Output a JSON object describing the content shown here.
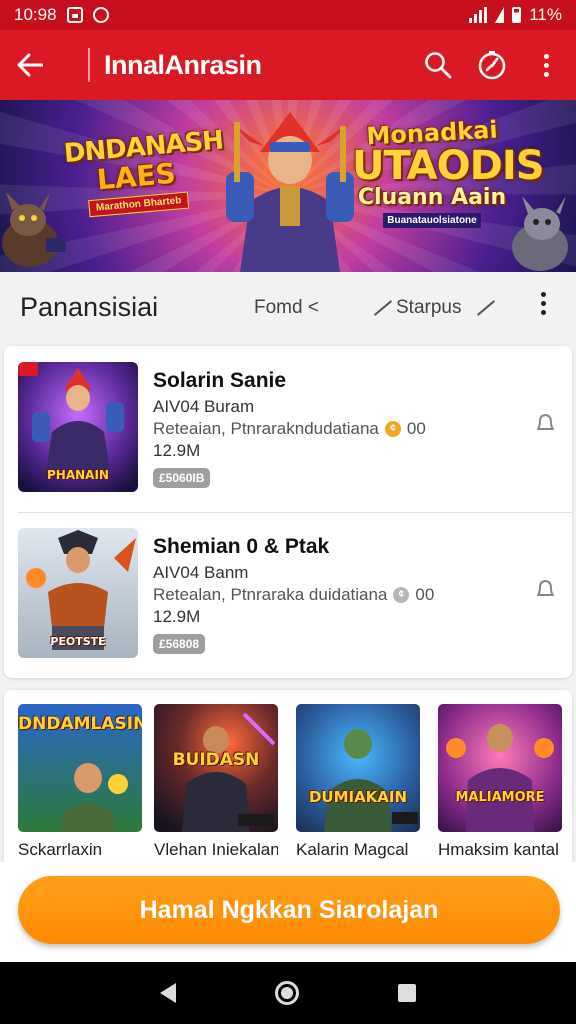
{
  "status_bar": {
    "time": "10:98",
    "battery": "11%"
  },
  "app_bar": {
    "title": "InnalAnrasin"
  },
  "banner": {
    "left_line1": "DNDANASH",
    "left_line2": "LAES",
    "left_tag": "Marathon Bharteb",
    "right_line1": "Monadkai",
    "right_line2": "UTAODIS",
    "right_line3": "Cluann Aain",
    "right_tag": "Buanatauolsiatone"
  },
  "section": {
    "title": "Panansisiai",
    "filter_fond": "Fomd <",
    "filter_status": "Starpus"
  },
  "games": [
    {
      "name": "Solarin Sanie",
      "sub": "AIV04 Buram",
      "desc": "Reteaian, Ptnrarakndudatiana",
      "rating": "00",
      "size": "12.9M",
      "badge": "£5060IB",
      "thumb_tag": "PHANAIN"
    },
    {
      "name": "Shemian 0 & Ptak",
      "sub": "AIV04 Banm",
      "desc": "Retealan, Ptnraraka duidatiana",
      "rating": "00",
      "size": "12.9M",
      "badge": "£56808",
      "thumb_tag": "PEOTSTE"
    }
  ],
  "featured": [
    {
      "title": "DNDAMLASIN",
      "label": "Sckarrlaxin"
    },
    {
      "title": "BUIDASN",
      "label": "Vlehan Iniekalan"
    },
    {
      "title": "DUMIAKAIN",
      "label": "Kalarin Magcal"
    },
    {
      "title": "MALIAMORE",
      "label": "Hmaksim kantal"
    }
  ],
  "cta": {
    "label": "Hamal Ngkkan Siarolajan"
  },
  "colors": {
    "header_red": "#d91a24",
    "status_red": "#c8101c",
    "cta_orange": "#ff8a00"
  }
}
